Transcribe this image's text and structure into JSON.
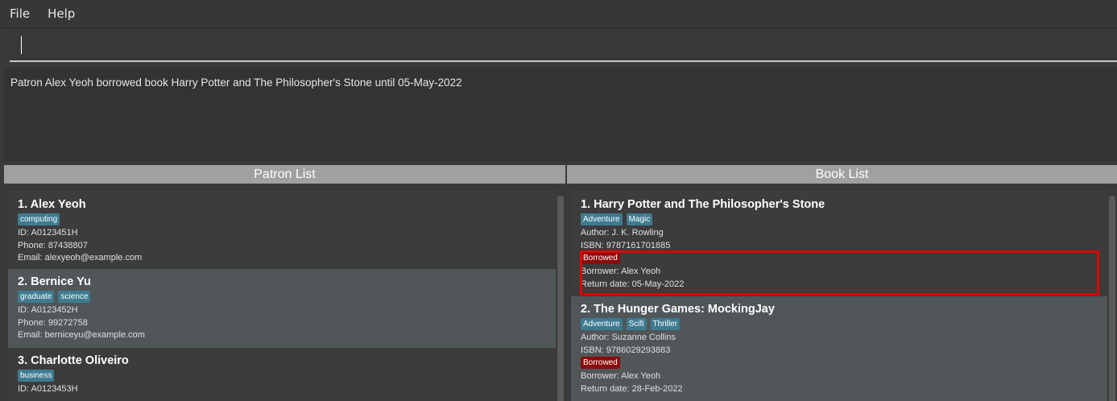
{
  "menu": {
    "file": "File",
    "help": "Help"
  },
  "command": {
    "value": "",
    "placeholder": ""
  },
  "result": {
    "text": "Patron Alex Yeoh borrowed book Harry Potter and The Philosopher's Stone until 05-May-2022"
  },
  "patron_panel": {
    "title": "Patron List",
    "items": [
      {
        "title": "1. Alex Yeoh",
        "tags": [
          "computing"
        ],
        "id": "ID: A0123451H",
        "phone": "Phone: 87438807",
        "email": "Email: alexyeoh@example.com"
      },
      {
        "title": "2. Bernice Yu",
        "tags": [
          "graduate",
          "science"
        ],
        "id": "ID: A0123452H",
        "phone": "Phone: 99272758",
        "email": "Email: berniceyu@example.com"
      },
      {
        "title": "3. Charlotte Oliveiro",
        "tags": [
          "business"
        ],
        "id": "ID: A0123453H",
        "phone": "",
        "email": ""
      }
    ]
  },
  "book_panel": {
    "title": "Book List",
    "items": [
      {
        "title": "1. Harry Potter and The Philosopher's Stone",
        "tags": [
          "Adventure",
          "Magic"
        ],
        "author": "Author: J. K. Rowling",
        "isbn": "ISBN: 9787161701885",
        "status": "Borrowed",
        "borrower": "Borrower: Alex Yeoh",
        "return_date": "Return date: 05-May-2022"
      },
      {
        "title": "2. The Hunger Games: MockingJay",
        "tags": [
          "Adventure",
          "Scifi",
          "Thriller"
        ],
        "author": "Author: Suzanne Collins",
        "isbn": "ISBN: 9786029293883",
        "status": "Borrowed",
        "borrower": "Borrower: Alex Yeoh",
        "return_date": "Return date: 28-Feb-2022"
      }
    ]
  },
  "colors": {
    "tag": "#3e7b91",
    "status_borrowed": "#8b0b0b",
    "highlight": "#e00000"
  }
}
